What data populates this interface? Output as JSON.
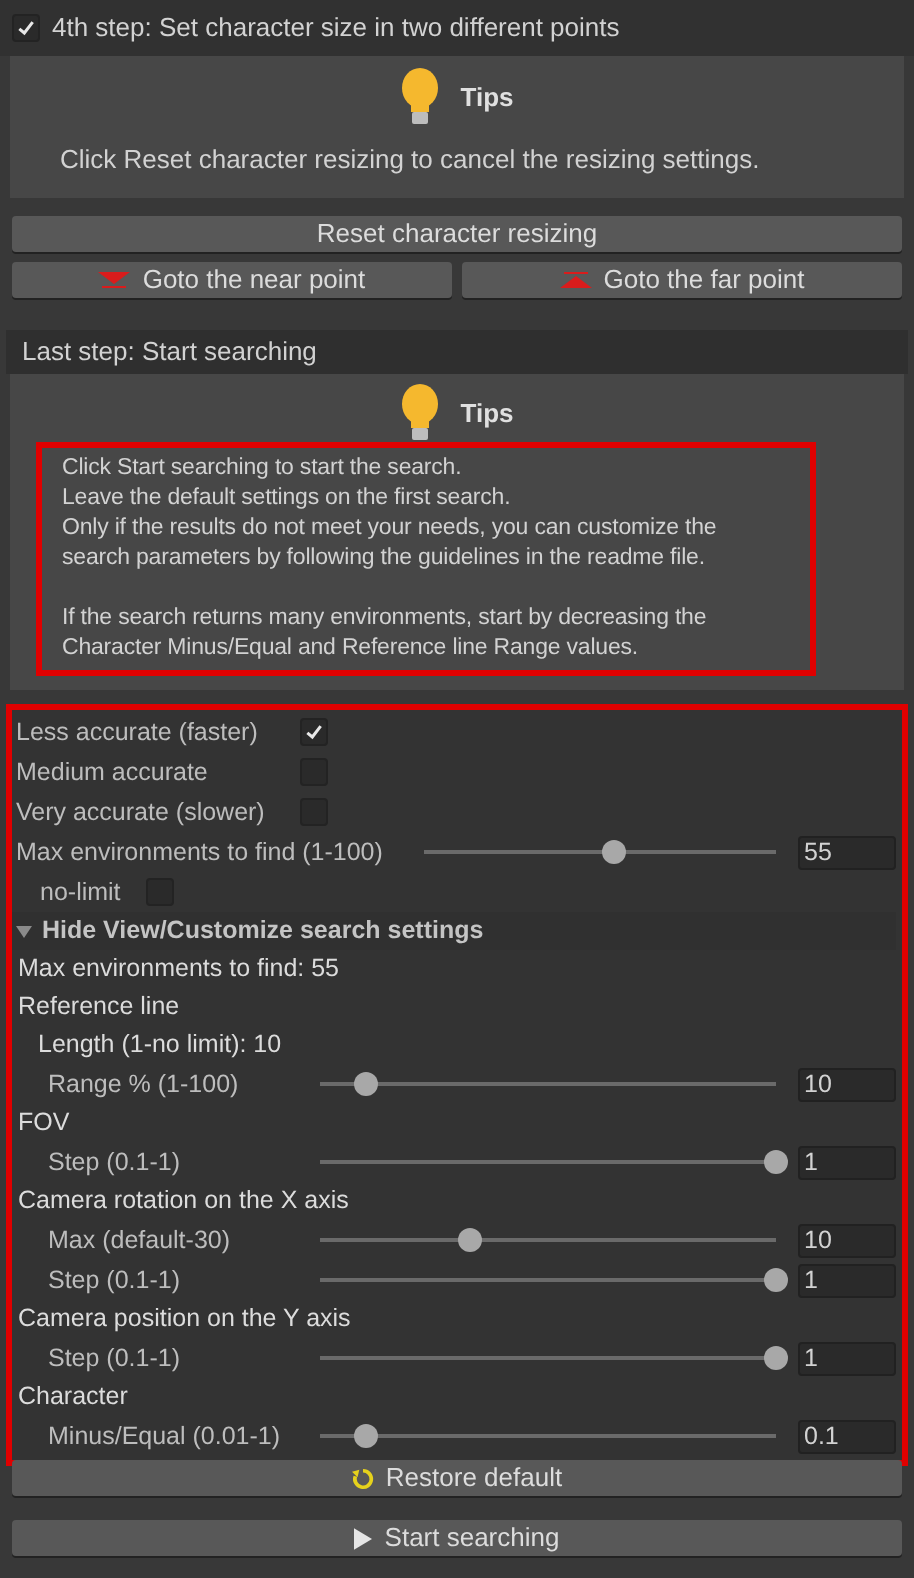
{
  "step4": {
    "checked": true,
    "label": "4th step: Set character size in two different points"
  },
  "tips1": {
    "title": "Tips",
    "text": "Click Reset character resizing to cancel the resizing settings."
  },
  "reset_button": "Reset character resizing",
  "goto_buttons": [
    "Goto the near point",
    "Goto the far point"
  ],
  "last_step": "Last step: Start searching",
  "tips2": {
    "title": "Tips",
    "lines": [
      "Click Start searching to start the search.",
      "Leave the default settings on the first search.",
      "Only if the results do not meet your needs, you can customize the search parameters by following the guidelines in the readme file.",
      "If the search returns many environments, start by decreasing the Character Minus/Equal and Reference line Range values."
    ]
  },
  "settings": [
    {
      "kind": "checkbox",
      "label": "Less accurate (faster)",
      "checked": true
    },
    {
      "kind": "checkbox",
      "label": "Medium accurate",
      "checked": false
    },
    {
      "kind": "checkbox",
      "label": "Very accurate (slower)",
      "checked": false
    },
    {
      "kind": "slider",
      "label": "Max environments to find (1-100)",
      "level": 0.54,
      "value": "55"
    },
    {
      "kind": "subcheckbox",
      "label": "no-limit",
      "checked": false
    },
    {
      "kind": "foldout",
      "label": "Hide View/Customize search settings",
      "expanded": true
    },
    {
      "kind": "text",
      "label": "Max environments to find: 55"
    },
    {
      "kind": "group",
      "label": "Reference line",
      "children": [
        {
          "kind": "text",
          "label": "Length (1-no limit): 10"
        },
        {
          "kind": "slider",
          "label": "Range % (1-100)",
          "level": 0.1,
          "value": "10"
        }
      ]
    },
    {
      "kind": "group",
      "label": "FOV",
      "children": [
        {
          "kind": "slider",
          "label": "Step (0.1-1)",
          "level": 1,
          "value": "1"
        }
      ]
    },
    {
      "kind": "group",
      "label": "Camera rotation on the X axis",
      "children": [
        {
          "kind": "slider",
          "label": "Max (default-30)",
          "level": 0.33,
          "value": "10"
        },
        {
          "kind": "slider",
          "label": "Step (0.1-1)",
          "level": 1,
          "value": "1"
        }
      ]
    },
    {
      "kind": "group",
      "label": "Camera position on the Y axis",
      "children": [
        {
          "kind": "slider",
          "label": "Step (0.1-1)",
          "level": 1,
          "value": "1"
        }
      ]
    },
    {
      "kind": "group",
      "label": "Character",
      "children": [
        {
          "kind": "slider",
          "label": "Minus/Equal (0.01-1)",
          "level": 0.1,
          "value": "0.1"
        }
      ]
    }
  ],
  "restore_button": "Restore default",
  "start_button": "Start searching"
}
